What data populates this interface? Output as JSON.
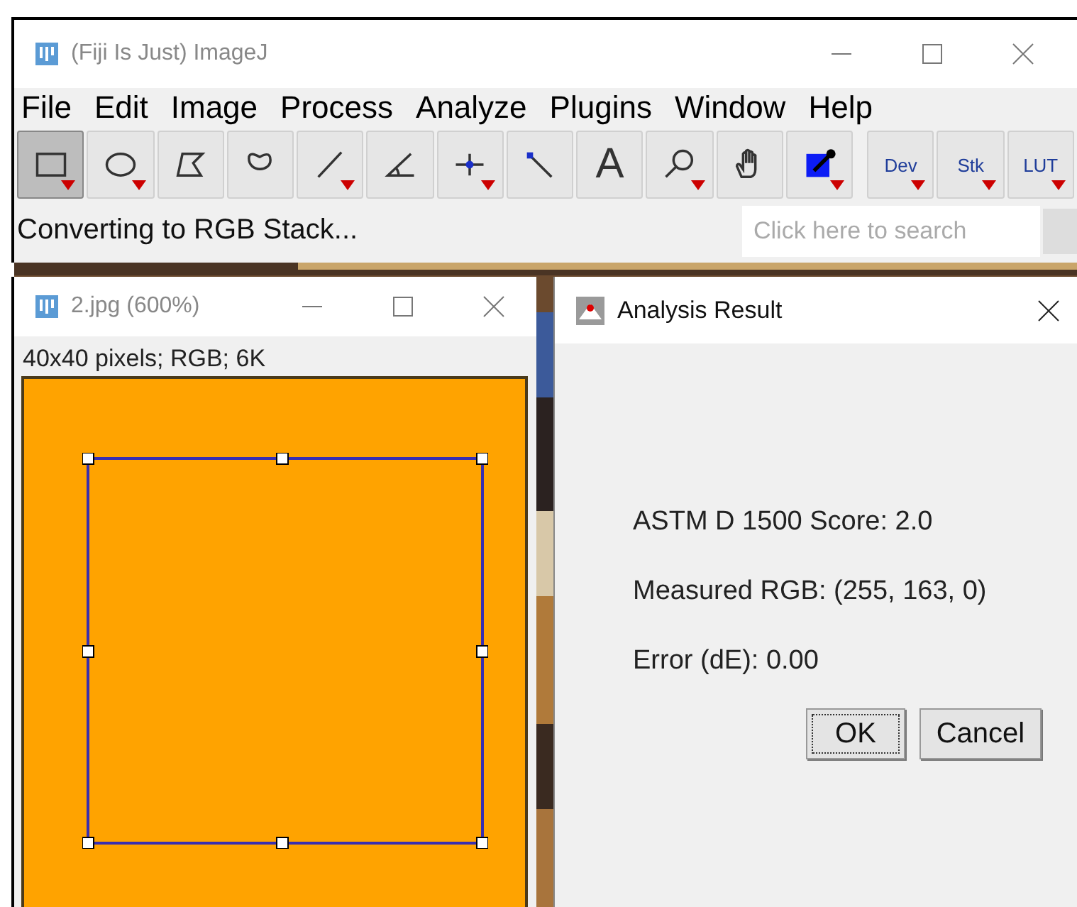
{
  "main_window": {
    "title": "(Fiji Is Just) ImageJ",
    "menu": [
      "File",
      "Edit",
      "Image",
      "Process",
      "Analyze",
      "Plugins",
      "Window",
      "Help"
    ],
    "tools": [
      {
        "kind": "rectangle",
        "selected": true,
        "menu": true
      },
      {
        "kind": "oval",
        "selected": false,
        "menu": true
      },
      {
        "kind": "polygon",
        "selected": false,
        "menu": false
      },
      {
        "kind": "freehand",
        "selected": false,
        "menu": false
      },
      {
        "kind": "line",
        "selected": false,
        "menu": true
      },
      {
        "kind": "angle",
        "selected": false,
        "menu": false
      },
      {
        "kind": "point",
        "selected": false,
        "menu": true
      },
      {
        "kind": "wand",
        "selected": false,
        "menu": false
      },
      {
        "kind": "text",
        "label": "A",
        "selected": false,
        "menu": false
      },
      {
        "kind": "magnifier",
        "selected": false,
        "menu": true
      },
      {
        "kind": "hand",
        "selected": false,
        "menu": false
      },
      {
        "kind": "dropper",
        "selected": false,
        "menu": true
      },
      {
        "kind": "label",
        "label": "Dev",
        "selected": false,
        "menu": true
      },
      {
        "kind": "label",
        "label": "Stk",
        "selected": false,
        "menu": true
      },
      {
        "kind": "label",
        "label": "LUT",
        "selected": false,
        "menu": true
      }
    ],
    "status": "Converting to RGB Stack...",
    "search": {
      "placeholder": "Click here to search"
    }
  },
  "image_window": {
    "title": "2.jpg (600%)",
    "info": "40x40 pixels; RGB; 6K"
  },
  "dialog": {
    "title": "Analysis Result",
    "lines": [
      "ASTM D 1500 Score: 2.0",
      "Measured RGB: (255, 163, 0)",
      "Error (dE): 0.00"
    ],
    "buttons": [
      {
        "label": "OK",
        "focused": true
      },
      {
        "label": "Cancel",
        "focused": false
      }
    ]
  }
}
